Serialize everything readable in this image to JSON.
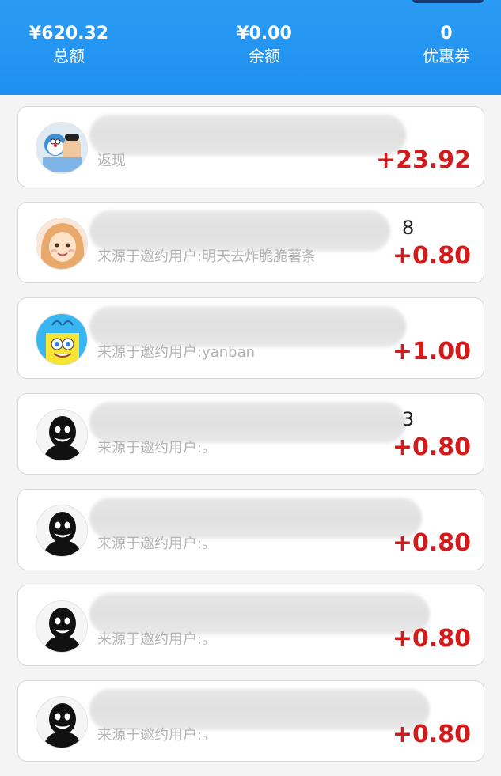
{
  "summary": {
    "total_value": "¥620.32",
    "total_label": "总额",
    "balance_value": "¥0.00",
    "balance_label": "余额",
    "coupon_value": "0",
    "coupon_label": "优惠券"
  },
  "colors": {
    "header": "#2196f3",
    "amount": "#d41b1b",
    "desc": "#b4b4b4"
  },
  "records": [
    {
      "avatar": "doraemon-avatar",
      "name_suffix": "",
      "desc": "返现",
      "amount": "+23.92"
    },
    {
      "avatar": "girl-cartoon-avatar",
      "name_suffix": "8",
      "desc": "来源于邀约用户:明天去炸脆脆薯条",
      "amount": "+0.80"
    },
    {
      "avatar": "spongebob-avatar",
      "name_suffix": "",
      "desc": "来源于邀约用户:yanban",
      "amount": "+1.00"
    },
    {
      "avatar": "dark-figure-avatar",
      "name_suffix": "3",
      "desc": "来源于邀约用户:。",
      "amount": "+0.80"
    },
    {
      "avatar": "dark-figure-avatar",
      "name_suffix": "",
      "desc": "来源于邀约用户:。",
      "amount": "+0.80"
    },
    {
      "avatar": "dark-figure-avatar",
      "name_suffix": "",
      "desc": "来源于邀约用户:。",
      "amount": "+0.80"
    },
    {
      "avatar": "dark-figure-avatar",
      "name_suffix": "",
      "desc": "来源于邀约用户:。",
      "amount": "+0.80"
    }
  ]
}
